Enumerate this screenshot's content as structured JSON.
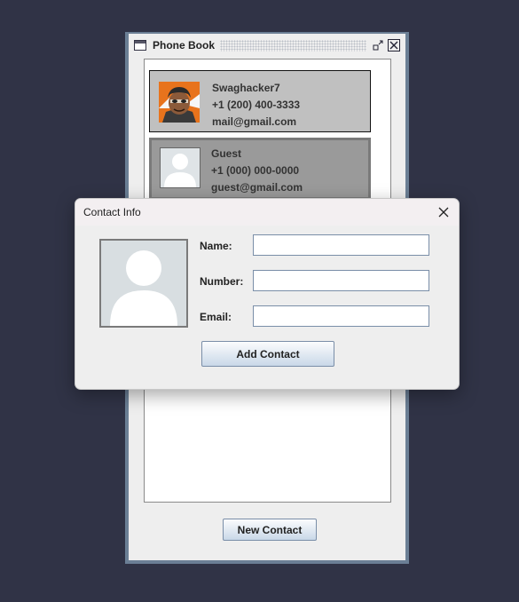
{
  "phone_book": {
    "title": "Phone Book",
    "contacts": [
      {
        "name": "Swaghacker7",
        "number": "+1 (200) 400-3333",
        "email": "mail@gmail.com",
        "avatar_icon": "cartoon-avatar-icon",
        "selected": false
      },
      {
        "name": "Guest",
        "number": "+1 (000) 000-0000",
        "email": "guest@gmail.com",
        "avatar_icon": "default-user-icon",
        "selected": true
      }
    ],
    "new_contact_label": "New Contact"
  },
  "dialog": {
    "title": "Contact Info",
    "fields": {
      "name_label": "Name:",
      "number_label": "Number:",
      "email_label": "Email:",
      "name_value": "",
      "number_value": "",
      "email_value": ""
    },
    "add_contact_label": "Add Contact"
  },
  "colors": {
    "desktop_background": "#303346",
    "window_border": "#6b7f95",
    "button_border": "#7a8ea8",
    "card_background": "#c0c0c0",
    "card_selected_background": "#9a9a9a"
  }
}
